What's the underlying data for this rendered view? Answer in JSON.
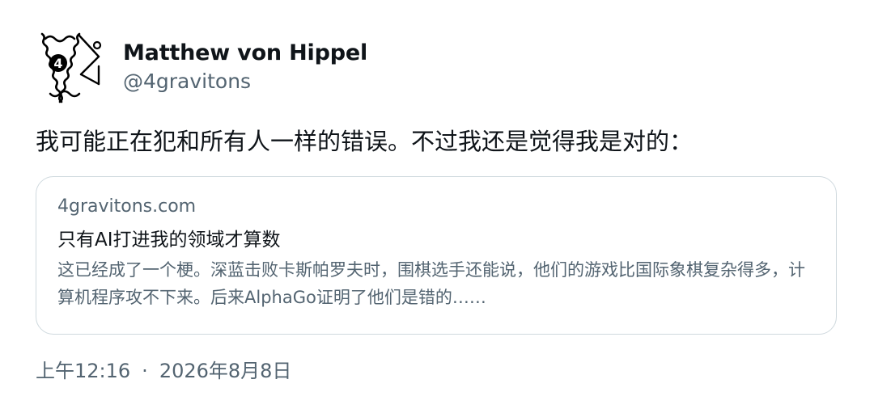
{
  "author": {
    "display_name": "Matthew von Hippel",
    "handle": "@4gravitons",
    "avatar_label": "4"
  },
  "tweet": {
    "text": "我可能正在犯和所有人一样的错误。不过我还是觉得我是对的："
  },
  "link_card": {
    "domain": "4gravitons.com",
    "title": "只有AI打进我的领域才算数",
    "description": "这已经成了一个梗。深蓝击败卡斯帕罗夫时，围棋选手还能说，他们的游戏比国际象棋复杂得多，计算机程序攻不下来。后来AlphaGo证明了他们是错的……"
  },
  "meta": {
    "time": "上午12:16",
    "separator": "·",
    "date": "2026年8月8日"
  },
  "colors": {
    "text_primary": "#0f1419",
    "text_secondary": "#536471",
    "border": "#cfd9de",
    "background": "#ffffff"
  }
}
